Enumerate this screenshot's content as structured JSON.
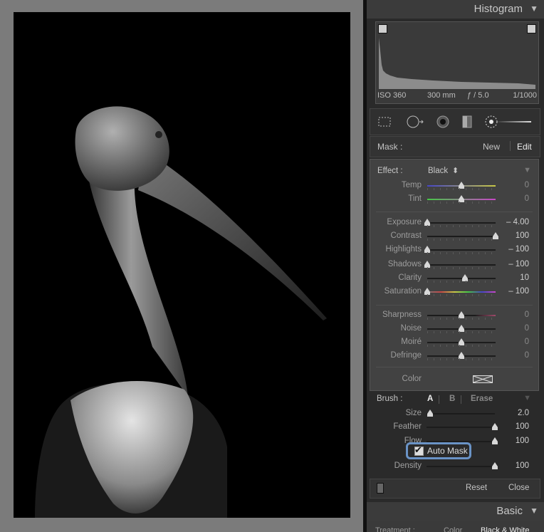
{
  "histogram": {
    "title": "Histogram",
    "iso": "ISO 360",
    "focal": "300 mm",
    "aperture": "ƒ / 5.0",
    "shutter": "1/1000"
  },
  "mask": {
    "label": "Mask :",
    "new": "New",
    "edit": "Edit"
  },
  "effect": {
    "label": "Effect :",
    "preset": "Black",
    "preset_arrows": "⬍",
    "rows": [
      {
        "label": "Temp",
        "value": "0",
        "pos": 0.5
      },
      {
        "label": "Tint",
        "value": "0",
        "pos": 0.5
      },
      {
        "label": "Exposure",
        "value": "– 4.00",
        "pos": 0.0
      },
      {
        "label": "Contrast",
        "value": "100",
        "pos": 1.0
      },
      {
        "label": "Highlights",
        "value": "– 100",
        "pos": 0.0
      },
      {
        "label": "Shadows",
        "value": "– 100",
        "pos": 0.0
      },
      {
        "label": "Clarity",
        "value": "10",
        "pos": 0.55
      },
      {
        "label": "Saturation",
        "value": "– 100",
        "pos": 0.0
      },
      {
        "label": "Sharpness",
        "value": "0",
        "pos": 0.5
      },
      {
        "label": "Noise",
        "value": "0",
        "pos": 0.5
      },
      {
        "label": "Moiré",
        "value": "0",
        "pos": 0.5
      },
      {
        "label": "Defringe",
        "value": "0",
        "pos": 0.5
      }
    ],
    "color_label": "Color"
  },
  "brush": {
    "label": "Brush :",
    "a": "A",
    "b": "B",
    "erase": "Erase",
    "rows": [
      {
        "label": "Size",
        "value": "2.0",
        "pos": 0.05
      },
      {
        "label": "Feather",
        "value": "100",
        "pos": 1.0
      },
      {
        "label": "Flow",
        "value": "100",
        "pos": 1.0
      },
      {
        "label": "Density",
        "value": "100",
        "pos": 1.0
      }
    ],
    "auto_mask": "Auto Mask",
    "auto_mask_checked": "✔",
    "auto_mask_highlight": "#6a93c6"
  },
  "footer": {
    "reset": "Reset",
    "close": "Close"
  },
  "basic": {
    "title": "Basic",
    "treatment": "Treatment :",
    "color": "Color",
    "bw": "Black & White"
  }
}
